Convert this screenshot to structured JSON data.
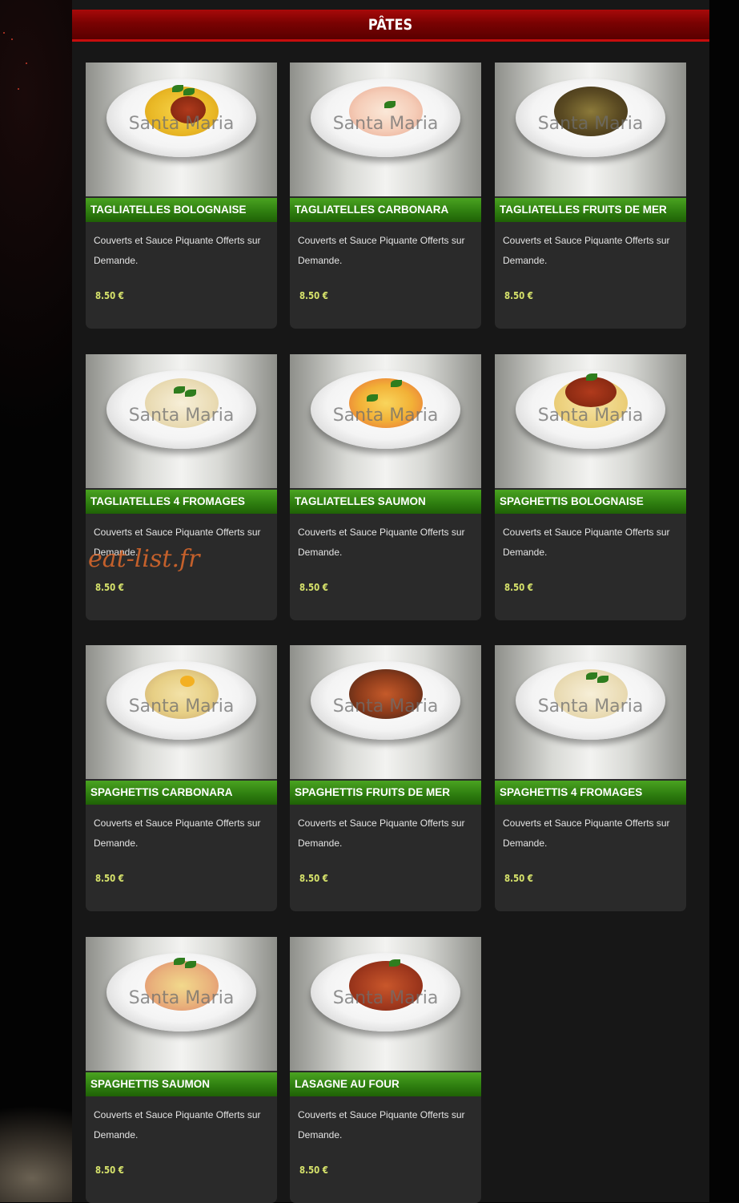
{
  "section": {
    "title": "PÂTES"
  },
  "watermark": {
    "photo": "Santa Maria",
    "overlay": "eat-list.fr"
  },
  "colors": {
    "header": "#8b0303",
    "name_bar": "#2f7f10",
    "price": "#d7e36b",
    "card": "#2a2a2a"
  },
  "items": [
    {
      "name": "TAGLIATELLES BOLOGNAISE",
      "description": "Couverts et Sauce Piquante Offerts sur Demande.",
      "price": "8.50 €"
    },
    {
      "name": "TAGLIATELLES CARBONARA",
      "description": "Couverts et Sauce Piquante Offerts sur Demande.",
      "price": "8.50 €"
    },
    {
      "name": "TAGLIATELLES FRUITS DE MER",
      "description": "Couverts et Sauce Piquante Offerts sur Demande.",
      "price": "8.50 €"
    },
    {
      "name": "TAGLIATELLES 4 FROMAGES",
      "description": "Couverts et Sauce Piquante Offerts sur Demande.",
      "price": "8.50 €"
    },
    {
      "name": "TAGLIATELLES SAUMON",
      "description": "Couverts et Sauce Piquante Offerts sur Demande.",
      "price": "8.50 €"
    },
    {
      "name": "SPAGHETTIS BOLOGNAISE",
      "description": "Couverts et Sauce Piquante Offerts sur Demande.",
      "price": "8.50 €"
    },
    {
      "name": "SPAGHETTIS CARBONARA",
      "description": "Couverts et Sauce Piquante Offerts sur Demande.",
      "price": "8.50 €"
    },
    {
      "name": "SPAGHETTIS FRUITS DE MER",
      "description": "Couverts et Sauce Piquante Offerts sur Demande.",
      "price": "8.50 €"
    },
    {
      "name": "SPAGHETTIS 4 FROMAGES",
      "description": "Couverts et Sauce Piquante Offerts sur Demande.",
      "price": "8.50 €"
    },
    {
      "name": "SPAGHETTIS SAUMON",
      "description": "Couverts et Sauce Piquante Offerts sur Demande.",
      "price": "8.50 €"
    },
    {
      "name": "LASAGNE AU FOUR",
      "description": "Couverts et Sauce Piquante Offerts sur Demande.",
      "price": "8.50 €"
    }
  ]
}
